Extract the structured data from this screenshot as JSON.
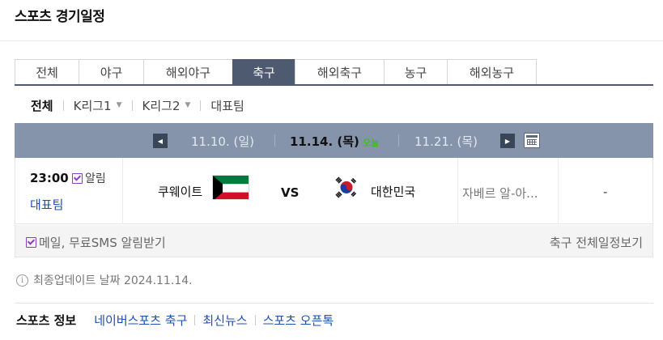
{
  "page": {
    "title": "스포츠 경기일정"
  },
  "tabs": [
    {
      "label": "전체",
      "active": false
    },
    {
      "label": "야구",
      "active": false
    },
    {
      "label": "해외야구",
      "active": false
    },
    {
      "label": "축구",
      "active": true
    },
    {
      "label": "해외축구",
      "active": false
    },
    {
      "label": "농구",
      "active": false
    },
    {
      "label": "해외농구",
      "active": false
    }
  ],
  "subnav": {
    "items": [
      "전체",
      "K리그1",
      "K리그2",
      "대표팀"
    ],
    "active": "전체"
  },
  "datebar": {
    "prev": "11.10. (일)",
    "current": "11.14. (목)",
    "today_badge": "오늘",
    "next": "11.21. (목)",
    "prev_icon": "triangle-left-icon",
    "next_icon": "triangle-right-icon",
    "calendar_icon": "calendar-icon"
  },
  "match": {
    "time": "23:00",
    "alarm_label": "알림",
    "category": "대표팀",
    "home_team": "쿠웨이트",
    "vs": "VS",
    "away_team": "대한민국",
    "broadcast": "자베르 알-아...",
    "result": "-"
  },
  "notice": {
    "sms_label": "메일, 무료SMS 알림받기",
    "full_schedule": "축구 전체일정보기"
  },
  "update": {
    "text": "최종업데이트 날짜 2024.11.14."
  },
  "sports_info": {
    "title": "스포츠 정보",
    "links": [
      "네이버스포츠 축구",
      "최신뉴스",
      "스포츠 오픈톡"
    ]
  },
  "colors": {
    "tab_active": "#4d5a70",
    "datebar": "#8593ab",
    "today": "#3cc11a",
    "link": "#1d4fb3",
    "check": "#8a3fc9"
  }
}
